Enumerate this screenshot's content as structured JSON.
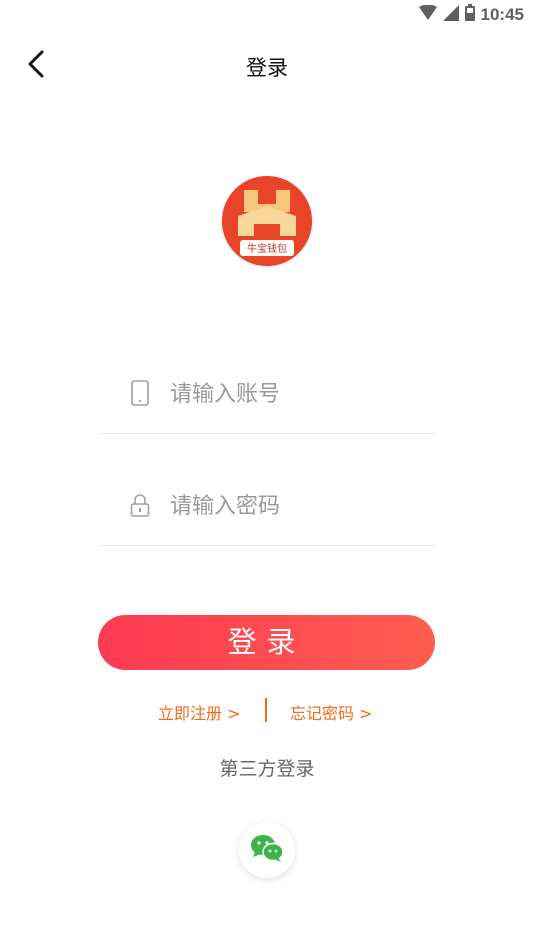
{
  "status_bar": {
    "time": "10:45",
    "icons": [
      "wifi-icon",
      "signal-icon",
      "battery-icon"
    ]
  },
  "nav": {
    "title": "登录",
    "back_icon": "chevron-left-icon"
  },
  "logo": {
    "caption": "牛宝钱包"
  },
  "form": {
    "account_placeholder": "请输入账号",
    "account_value": "",
    "password_placeholder": "请输入密码",
    "password_value": "",
    "account_icon": "phone-icon",
    "password_icon": "lock-icon"
  },
  "login_button": {
    "label": "登录"
  },
  "links": {
    "register": "立即注册 >",
    "forgot": "忘记密码 >"
  },
  "third_party": {
    "title": "第三方登录",
    "wechat_icon": "wechat-icon"
  },
  "colors": {
    "accent": "#fd3a52",
    "link": "#f26a18",
    "wechat": "#39b54a"
  }
}
